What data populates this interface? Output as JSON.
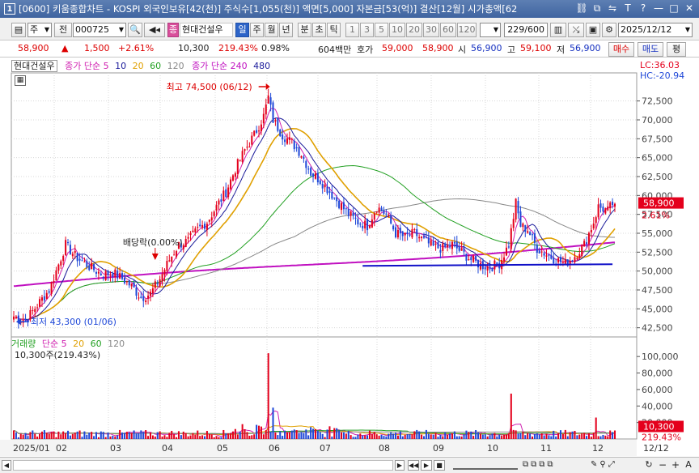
{
  "window": {
    "badge": "1",
    "title": "[0600] 키움종합차트 - KOSPI 외국인보유[42(천)] 주식수[1,055(천)] 액면[5,000] 자본금[53(억)] 결산[12월] 시가총액[62"
  },
  "toolbar": {
    "type_select": "주",
    "prev_label": "전",
    "code_value": "000725",
    "name_badge": "종",
    "stock_name": "현대건설우",
    "period_buttons": [
      "일",
      "주",
      "월",
      "년",
      "분",
      "초",
      "틱"
    ],
    "active_period": "일",
    "count_buttons": [
      "1",
      "3",
      "5",
      "10",
      "20",
      "30",
      "60",
      "120"
    ],
    "range_value": "229",
    "range_total": "/600",
    "date_value": "2025/12/12"
  },
  "quote": {
    "price": "58,900",
    "change": "1,500",
    "change_pct": "+2.61%",
    "volume": "10,300",
    "volume_pct": "219.43%",
    "turnover": "0.98%",
    "amount": "604백만",
    "bid_label": "호가",
    "bid1": "59,000",
    "bid2": "58,900",
    "open_label": "시",
    "open": "56,900",
    "high_label": "고",
    "high": "59,100",
    "low_label": "저",
    "low": "56,900",
    "buy_btn": "매수",
    "sell_btn": "매도",
    "eval_btn": "평"
  },
  "price_legend": {
    "name": "현대건설우",
    "ma_title": "종가 단순",
    "ma_periods": [
      "5",
      "10",
      "20",
      "60",
      "120"
    ],
    "ma2_title": "종가 단순",
    "ma2_periods": [
      "240",
      "480"
    ]
  },
  "volume_legend": {
    "title": "거래량",
    "ma_title": "단순",
    "ma_periods": [
      "5",
      "20",
      "60",
      "120"
    ],
    "current": "10,300주(219.43%)"
  },
  "annotations": {
    "high": "최고 74,500 (06/12)",
    "low": "최저 43,300 (01/06)",
    "dividend": "배당락(0.00%)",
    "lc": "LC:36.03",
    "hc": "HC:-20.94"
  },
  "price_axis": {
    "ticks": [
      "72,500",
      "70,000",
      "67,500",
      "65,000",
      "62,500",
      "60,000",
      "57,500",
      "55,000",
      "52,500",
      "50,000",
      "47,500",
      "45,000",
      "42,500"
    ],
    "current_label": "58,900",
    "current_pct": "2.61%"
  },
  "volume_axis": {
    "ticks": [
      "100,000",
      "80,000",
      "60,000",
      "40,000",
      "20,000"
    ],
    "current_label": "10,300",
    "current_pct": "219.43%"
  },
  "date_axis": {
    "labels": [
      "2025/01",
      "02",
      "03",
      "04",
      "05",
      "06",
      "07",
      "08",
      "09",
      "10",
      "11",
      "12"
    ],
    "right_label": "12/12"
  },
  "colors": {
    "up": "#e4001c",
    "down": "#1f48d8",
    "ma5": "#d020b0",
    "ma10": "#1a1a9a",
    "ma20": "#e0a000",
    "ma60": "#22a022",
    "ma120": "#888888",
    "ma240": "#c010c0",
    "support": "#1010c8"
  },
  "chart_data": {
    "type": "candlestick",
    "price_range": [
      41500,
      76000
    ],
    "volume_range": [
      0,
      110000
    ],
    "support_level": 50900,
    "anchors": [
      [
        0,
        44000
      ],
      [
        5,
        43500
      ],
      [
        10,
        45500
      ],
      [
        15,
        47500
      ],
      [
        18,
        50000
      ],
      [
        22,
        53500
      ],
      [
        26,
        52000
      ],
      [
        30,
        51000
      ],
      [
        34,
        50200
      ],
      [
        38,
        49500
      ],
      [
        42,
        49800
      ],
      [
        46,
        49000
      ],
      [
        50,
        48000
      ],
      [
        54,
        46500
      ],
      [
        58,
        47000
      ],
      [
        62,
        49000
      ],
      [
        66,
        51500
      ],
      [
        70,
        53500
      ],
      [
        74,
        54000
      ],
      [
        78,
        55500
      ],
      [
        82,
        56500
      ],
      [
        86,
        58500
      ],
      [
        90,
        60500
      ],
      [
        94,
        63500
      ],
      [
        98,
        66000
      ],
      [
        102,
        68000
      ],
      [
        106,
        70500
      ],
      [
        108,
        73000
      ],
      [
        110,
        70000
      ],
      [
        114,
        68000
      ],
      [
        118,
        67000
      ],
      [
        122,
        65500
      ],
      [
        126,
        63000
      ],
      [
        130,
        62000
      ],
      [
        134,
        60500
      ],
      [
        138,
        59000
      ],
      [
        142,
        57500
      ],
      [
        146,
        56500
      ],
      [
        150,
        56000
      ],
      [
        154,
        58500
      ],
      [
        158,
        57500
      ],
      [
        162,
        55000
      ],
      [
        166,
        54500
      ],
      [
        170,
        55000
      ],
      [
        174,
        54000
      ],
      [
        178,
        53200
      ],
      [
        182,
        53000
      ],
      [
        186,
        53500
      ],
      [
        190,
        52500
      ],
      [
        194,
        51500
      ],
      [
        198,
        50800
      ],
      [
        202,
        50500
      ],
      [
        206,
        51000
      ],
      [
        210,
        53500
      ],
      [
        213,
        59000
      ],
      [
        215,
        56000
      ],
      [
        218,
        55500
      ],
      [
        222,
        53000
      ],
      [
        226,
        52200
      ],
      [
        230,
        51500
      ],
      [
        234,
        51000
      ],
      [
        238,
        52000
      ],
      [
        242,
        53500
      ],
      [
        246,
        56500
      ],
      [
        248,
        58500
      ],
      [
        252,
        58000
      ],
      [
        254,
        58900
      ]
    ],
    "volume_spikes": [
      [
        108,
        104000
      ],
      [
        211,
        55000
      ],
      [
        247,
        26000
      ],
      [
        110,
        38000
      ],
      [
        97,
        18000
      ]
    ]
  }
}
